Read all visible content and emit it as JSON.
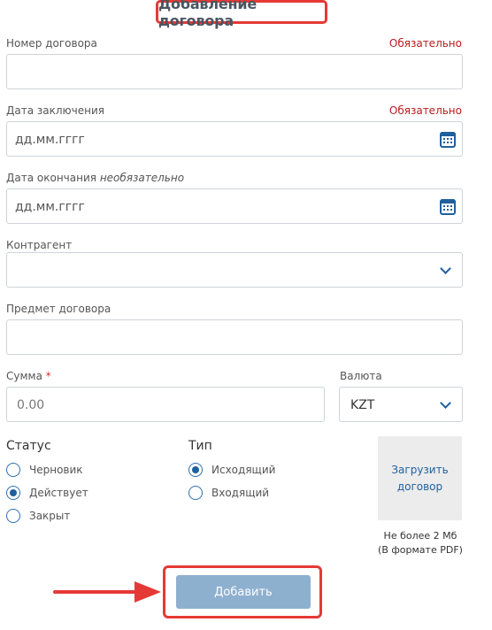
{
  "form": {
    "title": "Добавление договора",
    "contract_number": {
      "label": "Номер договора",
      "required_text": "Обязательно",
      "value": ""
    },
    "conclusion_date": {
      "label": "Дата заключения",
      "required_text": "Обязательно",
      "placeholder": "дд.мм.гггг"
    },
    "end_date": {
      "label": "Дата окончания",
      "optional_text": "необязательно",
      "placeholder": "дд.мм.гггг"
    },
    "counterparty": {
      "label": "Контрагент",
      "value": ""
    },
    "subject": {
      "label": "Предмет договора",
      "value": ""
    },
    "amount": {
      "label": "Сумма",
      "required_mark": "*",
      "placeholder": "0.00"
    },
    "currency": {
      "label": "Валюта",
      "value": "KZT"
    },
    "status": {
      "label": "Статус",
      "options": [
        "Черновик",
        "Действует",
        "Закрыт"
      ],
      "selected": "Действует"
    },
    "type": {
      "label": "Тип",
      "options": [
        "Исходящий",
        "Входящий"
      ],
      "selected": "Исходящий"
    },
    "upload": {
      "label_line1": "Загрузить",
      "label_line2": "договор",
      "note_line1": "Не более 2 Мб",
      "note_line2": "(В формате PDF)"
    },
    "submit_label": "Добавить"
  },
  "colors": {
    "highlight": "#e53935",
    "accent": "#1f5f9e",
    "required": "#b71c1c",
    "button_bg": "#8eb0cf"
  }
}
